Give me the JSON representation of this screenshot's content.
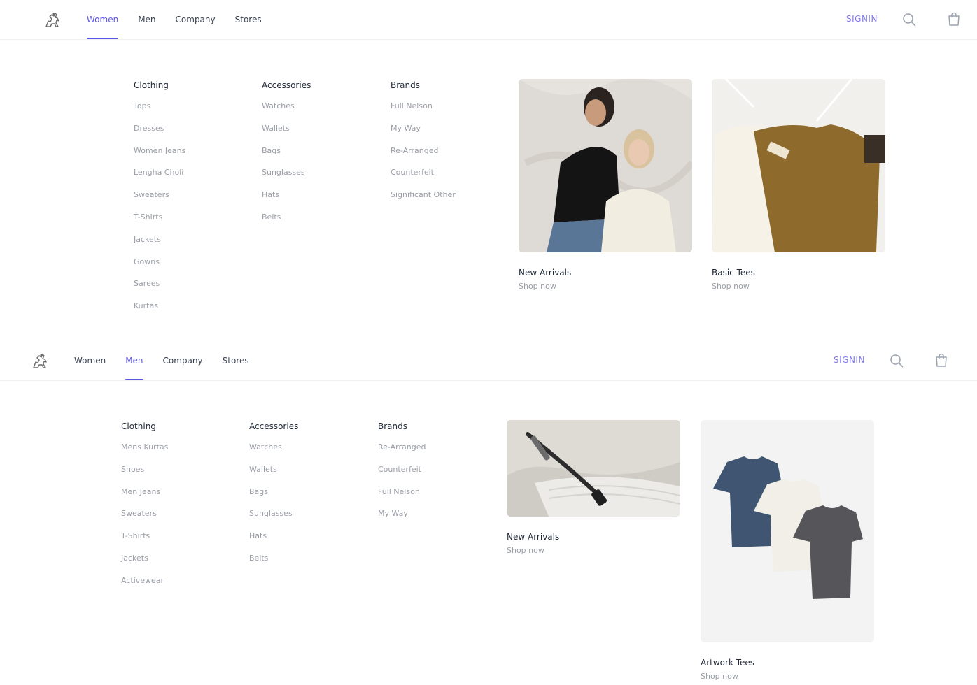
{
  "colors": {
    "accent": "#5b55e6",
    "signin": "#7f79f0",
    "muted_text": "#9a9ea6",
    "heading_text": "#1f2937"
  },
  "women_view": {
    "nav": {
      "logo_icon": "horse-rider-logo-icon",
      "links": [
        "Women",
        "Men",
        "Company",
        "Stores"
      ],
      "active": "Women",
      "signin": "SIGNIN",
      "search_icon": "search-icon",
      "bag_icon": "shopping-bag-icon"
    },
    "columns": [
      {
        "title": "Clothing",
        "items": [
          "Tops",
          "Dresses",
          "Women Jeans",
          "Lengha Choli",
          "Sweaters",
          "T-Shirts",
          "Jackets",
          "Gowns",
          "Sarees",
          "Kurtas"
        ]
      },
      {
        "title": "Accessories",
        "items": [
          "Watches",
          "Wallets",
          "Bags",
          "Sunglasses",
          "Hats",
          "Belts"
        ]
      },
      {
        "title": "Brands",
        "items": [
          "Full Nelson",
          "My Way",
          "Re-Arranged",
          "Counterfeit",
          "Significant Other"
        ]
      }
    ],
    "features": [
      {
        "name": "New Arrivals",
        "cta": "Shop now"
      },
      {
        "name": "Basic Tees",
        "cta": "Shop now"
      }
    ]
  },
  "men_view": {
    "nav": {
      "logo_icon": "horse-rider-logo-icon",
      "links": [
        "Women",
        "Men",
        "Company",
        "Stores"
      ],
      "active": "Men",
      "signin": "SIGNIN",
      "search_icon": "search-icon",
      "bag_icon": "shopping-bag-icon"
    },
    "columns": [
      {
        "title": "Clothing",
        "items": [
          "Mens Kurtas",
          "Shoes",
          "Men Jeans",
          "Sweaters",
          "T-Shirts",
          "Jackets",
          "Activewear"
        ]
      },
      {
        "title": "Accessories",
        "items": [
          "Watches",
          "Wallets",
          "Bags",
          "Sunglasses",
          "Hats",
          "Belts"
        ]
      },
      {
        "title": "Brands",
        "items": [
          "Re-Arranged",
          "Counterfeit",
          "Full Nelson",
          "My Way"
        ]
      }
    ],
    "features": [
      {
        "name": "New Arrivals",
        "cta": "Shop now"
      },
      {
        "name": "Artwork Tees",
        "cta": "Shop now"
      }
    ]
  }
}
